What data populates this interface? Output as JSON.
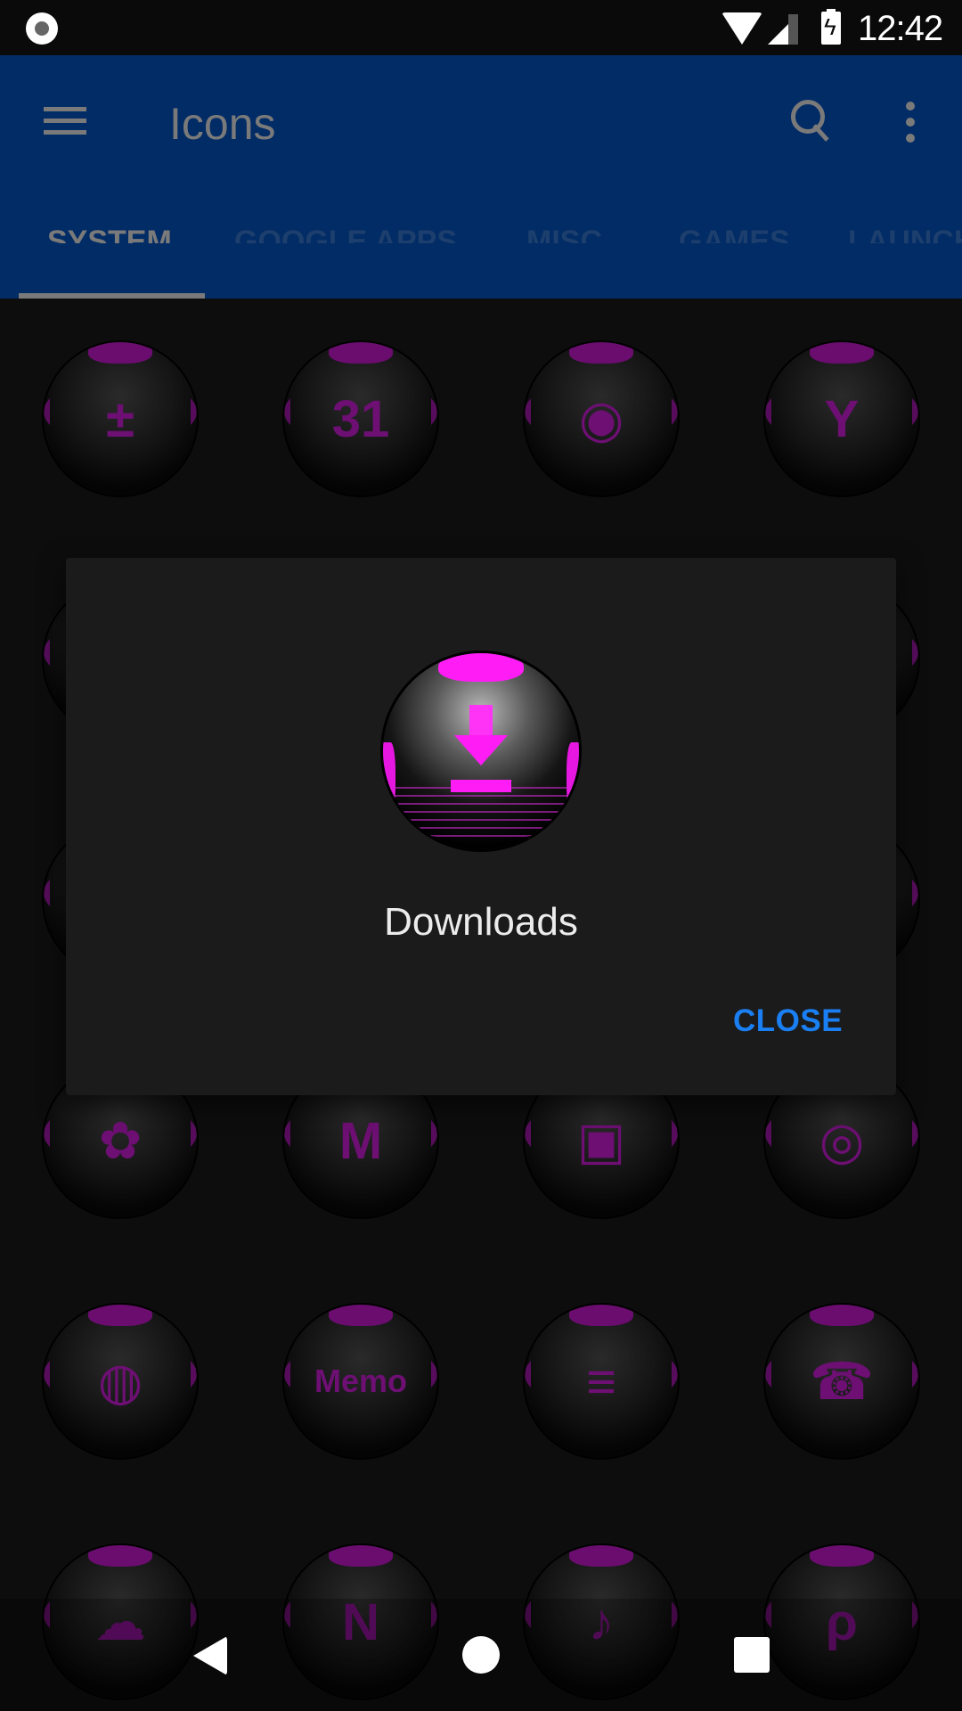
{
  "status_bar": {
    "time": "12:42",
    "icons": [
      "notification-dot-icon",
      "wifi-icon",
      "cellular-signal-icon",
      "battery-charging-icon"
    ]
  },
  "toolbar": {
    "title": "Icons",
    "menu_icon": "hamburger-menu-icon",
    "search_icon": "search-icon",
    "more_icon": "more-vert-icon",
    "color": "#022c66"
  },
  "tabs": [
    {
      "label": "SYSTEM",
      "active": true
    },
    {
      "label": "GOOGLE APPS",
      "active": false
    },
    {
      "label": "MISC",
      "active": false
    },
    {
      "label": "GAMES",
      "active": false
    },
    {
      "label": "LAUNCH",
      "active": false
    }
  ],
  "grid": {
    "accent_color": "#6d0f73",
    "icons": [
      {
        "name": "calculator",
        "glyph": "±"
      },
      {
        "name": "calendar",
        "glyph": "31"
      },
      {
        "name": "camera",
        "glyph": "◉"
      },
      {
        "name": "clock",
        "glyph": "Y"
      },
      {
        "name": "hidden-1",
        "glyph": ""
      },
      {
        "name": "hidden-2",
        "glyph": ""
      },
      {
        "name": "hidden-3",
        "glyph": ""
      },
      {
        "name": "hidden-4",
        "glyph": ""
      },
      {
        "name": "hidden-5",
        "glyph": ""
      },
      {
        "name": "hidden-6",
        "glyph": ""
      },
      {
        "name": "hidden-7",
        "glyph": ""
      },
      {
        "name": "hidden-8",
        "glyph": ""
      },
      {
        "name": "flower",
        "glyph": "✿"
      },
      {
        "name": "gmail",
        "glyph": "M"
      },
      {
        "name": "paint-chart",
        "glyph": "▣"
      },
      {
        "name": "instagram",
        "glyph": "◎"
      },
      {
        "name": "globe",
        "glyph": "◍"
      },
      {
        "name": "memo",
        "glyph": "Memo"
      },
      {
        "name": "messages",
        "glyph": "≡"
      },
      {
        "name": "phone",
        "glyph": "☎"
      },
      {
        "name": "cloud",
        "glyph": "☁"
      },
      {
        "name": "onenote",
        "glyph": "N"
      },
      {
        "name": "music-equalizer",
        "glyph": "♪"
      },
      {
        "name": "pinterest",
        "glyph": "ρ"
      }
    ]
  },
  "dialog": {
    "title": "Downloads",
    "icon": "download-icon",
    "close_label": "CLOSE",
    "accent_color": "#ff1cf5",
    "button_color": "#1a7ff2"
  },
  "nav_bar": {
    "back": "back-icon",
    "home": "home-icon",
    "recents": "recents-icon"
  }
}
